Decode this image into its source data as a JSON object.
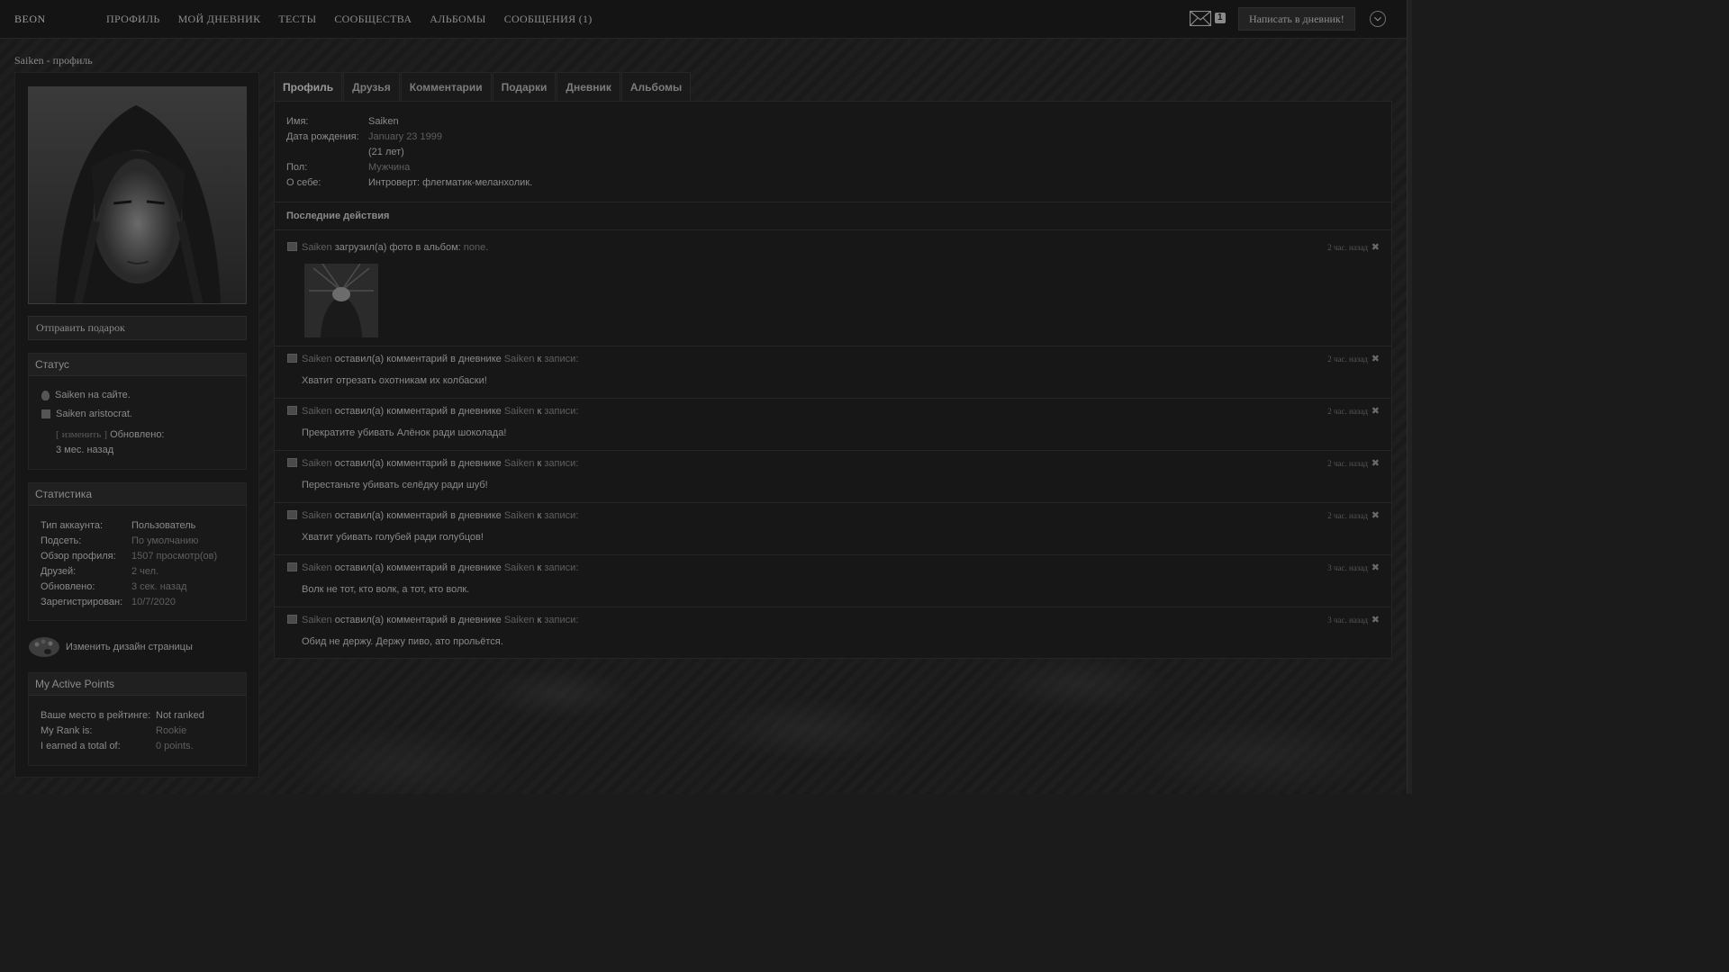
{
  "brand": "BEON",
  "nav": [
    "ПРОФИЛЬ",
    "МОЙ ДНЕВНИК",
    "ТЕСТЫ",
    "СООБЩЕСТВА",
    "АЛЬБОМЫ",
    "СООБЩЕНИЯ (1)"
  ],
  "header": {
    "mail_count": "1",
    "write_button": "Написать в дневник!",
    "mail_icon": "envelope-icon",
    "dropdown_icon": "chevron-down-icon"
  },
  "page_title": "Saiken - профиль",
  "sidebar": {
    "gift_button": "Отправить подарок",
    "status": {
      "title": "Статус",
      "online": "Saiken на сайте.",
      "status_text": "Saiken aristocrat.",
      "edit_open": "[",
      "edit_link": "изменить",
      "edit_close": "]",
      "updated_label": "Обновлено:",
      "updated_value": "3 мес. назад"
    },
    "stats": {
      "title": "Статистика",
      "rows": [
        {
          "k": "Тип аккаунта:",
          "v": "Пользователь"
        },
        {
          "k": "Подсеть:",
          "v": "По умолчанию"
        },
        {
          "k": "Обзор профиля:",
          "v": "1507 просмотр(ов)"
        },
        {
          "k": "Друзей:",
          "v": "2 чел."
        },
        {
          "k": "Обновлено:",
          "v": "3 сек. назад"
        },
        {
          "k": "Зарегистрирован:",
          "v": "10/7/2020"
        }
      ]
    },
    "design_link": "Изменить дизайн страницы",
    "points": {
      "title": "My Active Points",
      "rows": [
        {
          "k": "Ваше место в рейтинге:",
          "v": "Not ranked"
        },
        {
          "k": "My Rank is:",
          "v": "Rookie"
        },
        {
          "k": "I earned a total of:",
          "v": "0 points."
        }
      ]
    }
  },
  "tabs": [
    "Профиль",
    "Друзья",
    "Комментарии",
    "Подарки",
    "Дневник",
    "Альбомы"
  ],
  "profile": {
    "name_label": "Имя:",
    "name": "Saiken",
    "birth_label": "Дата рождения:",
    "birth": "January 23 1999",
    "age": "(21 лет)",
    "gender_label": "Пол:",
    "gender": "Мужчина",
    "about_label": "О себе:",
    "about": "Интроверт: флегматик-меланхолик."
  },
  "activity": {
    "title": "Последние действия",
    "photo": {
      "user": "Saiken",
      "action": " загрузил(а) фото в альбом: ",
      "album": "none.",
      "time": "2 час. назад"
    },
    "comment_action": " оставил(а) комментарий в дневнике ",
    "comment_to": " к ",
    "comment_link": "записи",
    "comments": [
      {
        "user": "Saiken",
        "owner": "Saiken",
        "time": "2 час. назад",
        "text": "Хватит отрезать охотникам их колбаски!"
      },
      {
        "user": "Saiken",
        "owner": "Saiken",
        "time": "2 час. назад",
        "text": "Прекратите убивать Алёнок ради шоколада!"
      },
      {
        "user": "Saiken",
        "owner": "Saiken",
        "time": "2 час. назад",
        "text": "Перестаньте убивать селёдку ради шуб!"
      },
      {
        "user": "Saiken",
        "owner": "Saiken",
        "time": "2 час. назад",
        "text": "Хватит убивать голубей ради голубцов!"
      },
      {
        "user": "Saiken",
        "owner": "Saiken",
        "time": "3 час. назад",
        "text": "Волк не тот, кто волк, а тот, кто волк."
      },
      {
        "user": "Saiken",
        "owner": "Saiken",
        "time": "3 час. назад",
        "text": "Обид не держу. Держу пиво, ато прольётся."
      }
    ]
  }
}
